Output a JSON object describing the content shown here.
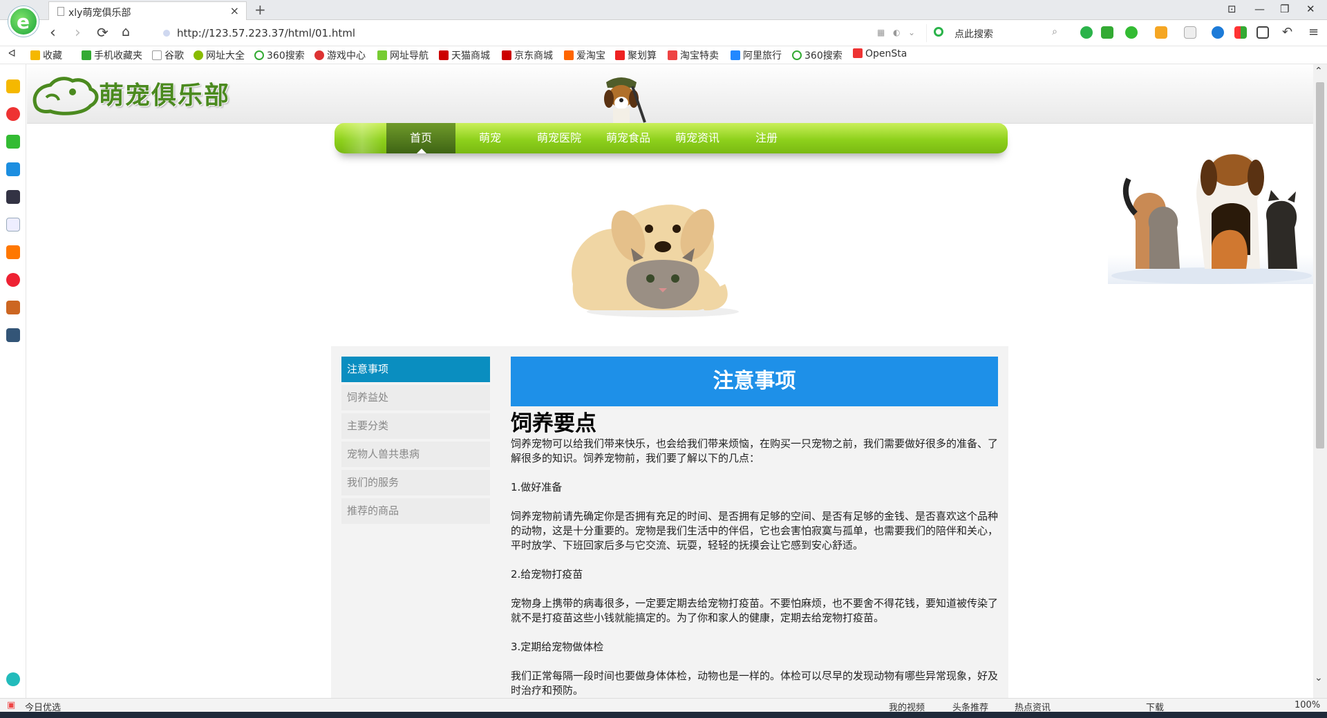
{
  "browser": {
    "tab_title": "xly萌宠俱乐部",
    "tab_close": "×",
    "new_tab": "+",
    "url": "http://123.57.223.37/html/01.html",
    "search_placeholder": "点此搜索",
    "logo_letter": "e",
    "window_controls": [
      "⊡",
      "—",
      "❐",
      "✕"
    ],
    "favorites": [
      "收藏",
      "手机收藏夹",
      "谷歌",
      "网址大全",
      "360搜索",
      "游戏中心",
      "网址导航",
      "天猫商城",
      "京东商城",
      "爱淘宝",
      "聚划算",
      "淘宝特卖",
      "阿里旅行",
      "360搜索",
      "OpenSta"
    ],
    "status_left": "今日优选",
    "status_items": [
      "我的视频",
      "头条推荐",
      "热点资讯",
      "下载",
      "100%"
    ]
  },
  "site": {
    "logo_text": "萌宠俱乐部",
    "nav": [
      "首页",
      "萌宠",
      "萌宠医院",
      "萌宠食品",
      "萌宠资讯",
      "注册"
    ],
    "active_nav": 0,
    "sidebar_menu": [
      "注意事项",
      "饲养益处",
      "主要分类",
      "宠物人兽共患病",
      "我们的服务",
      "推荐的商品"
    ],
    "active_menu": 0
  },
  "article": {
    "banner": "注意事项",
    "heading": "饲养要点",
    "paragraphs": [
      "饲养宠物可以给我们带来快乐，也会给我们带来烦恼，在购买一只宠物之前，我们需要做好很多的准备、了解很多的知识。饲养宠物前，我们要了解以下的几点：",
      "1.做好准备",
      "饲养宠物前请先确定你是否拥有充足的时间、是否拥有足够的空间、是否有足够的金钱、是否喜欢这个品种的动物，这是十分重要的。宠物是我们生活中的伴侣，它也会害怕寂寞与孤单，也需要我们的陪伴和关心，平时放学、下班回家后多与它交流、玩耍，轻轻的抚摸会让它感到安心舒适。",
      "2.给宠物打疫苗",
      "宠物身上携带的病毒很多，一定要定期去给宠物打疫苗。不要怕麻烦，也不要舍不得花钱，要知道被传染了就不是打疫苗这些小钱就能搞定的。为了你和家人的健康，定期去给宠物打疫苗。",
      "3.定期给宠物做体检",
      "我们正常每隔一段时间也要做身体体检，动物也是一样的。体检可以尽早的发现动物有哪些异常现象，好及时治疗和预防。"
    ]
  },
  "colors": {
    "nav_green": "#8ed11c",
    "banner_blue": "#1e90e8",
    "menu_active": "#0a8ec0",
    "logo_green": "#4b8a1f"
  }
}
